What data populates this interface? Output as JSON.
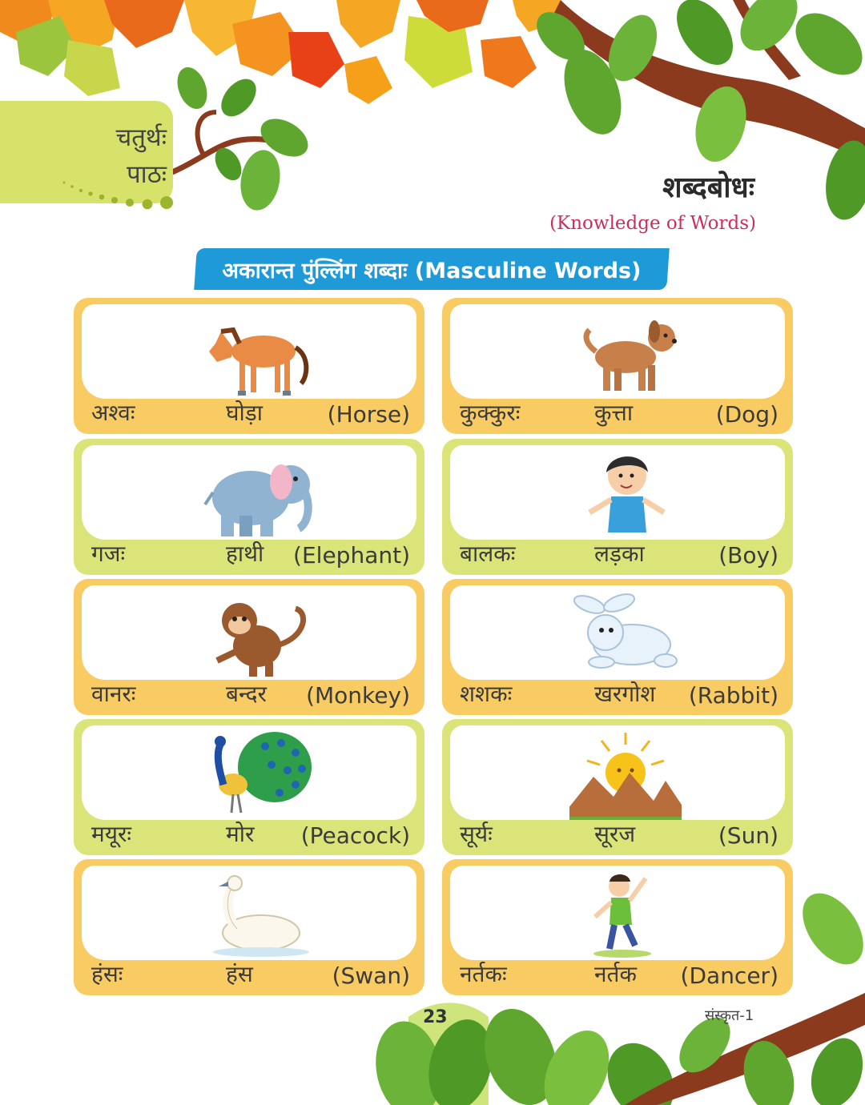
{
  "chapter": {
    "line1": "चतुर्थः",
    "line2": "पाठः"
  },
  "title": "शब्दबोधः",
  "subtitle": "(Knowledge of Words)",
  "section_banner": "अकारान्त पुंल्लिंग शब्दाः (Masculine Words)",
  "cards": [
    {
      "sanskrit": "अश्वः",
      "hindi": "घोड़ा",
      "english": "(Horse)",
      "image": "horse",
      "color": "#f9cb63"
    },
    {
      "sanskrit": "कुक्कुरः",
      "hindi": "कुत्ता",
      "english": "(Dog)",
      "image": "dog",
      "color": "#f9cb63"
    },
    {
      "sanskrit": "गजः",
      "hindi": "हाथी",
      "english": "(Elephant)",
      "image": "elephant",
      "color": "#dbe478"
    },
    {
      "sanskrit": "बालकः",
      "hindi": "लड़का",
      "english": "(Boy)",
      "image": "boy",
      "color": "#dbe478"
    },
    {
      "sanskrit": "वानरः",
      "hindi": "बन्दर",
      "english": "(Monkey)",
      "image": "monkey",
      "color": "#f9cb63"
    },
    {
      "sanskrit": "शशकः",
      "hindi": "खरगोश",
      "english": "(Rabbit)",
      "image": "rabbit",
      "color": "#f9cb63"
    },
    {
      "sanskrit": "मयूरः",
      "hindi": "मोर",
      "english": "(Peacock)",
      "image": "peacock",
      "color": "#dbe478"
    },
    {
      "sanskrit": "सूर्यः",
      "hindi": "सूरज",
      "english": "(Sun)",
      "image": "sun",
      "color": "#dbe478"
    },
    {
      "sanskrit": "हंसः",
      "hindi": "हंस",
      "english": "(Swan)",
      "image": "swan",
      "color": "#f9cb63"
    },
    {
      "sanskrit": "नर्तकः",
      "hindi": "नर्तक",
      "english": "(Dancer)",
      "image": "dancer",
      "color": "#f9cb63"
    }
  ],
  "footer": {
    "page_number": "23",
    "book": "संस्कृत-1"
  }
}
